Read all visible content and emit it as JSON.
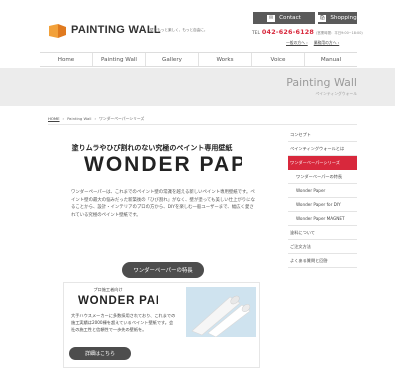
{
  "header": {
    "logo_text": "PAINTING WALL",
    "tagline": "壁をもっと楽しく、もっと自由に。",
    "contact_label": "Contact",
    "shop_label": "Shopping",
    "tel_prefix": "TEL",
    "tel_number": "042-626-6128",
    "tel_hours": "(営業時間：平日9:00~18:00)",
    "links": [
      "一般の方へ ›",
      "業務用の方へ ›"
    ]
  },
  "nav": {
    "items": [
      "Home",
      "Painting Wall",
      "Gallery",
      "Works",
      "Voice",
      "Manual"
    ]
  },
  "band": {
    "title": "Painting Wall",
    "subtitle": "ペインティングウォール"
  },
  "breadcrumb": {
    "items": [
      "HOME",
      "Painting Wall",
      "ワンダーペーパーシリーズ"
    ],
    "separator": "›"
  },
  "main": {
    "headline": "塗りムラやひび割れのない究極のペイント専用壁紙",
    "logo_big": "WONDER PAPER",
    "description": "ワンダーペーパーは、これまでのペイント壁の常識を越える新しいペイント専用壁紙です。ペイント壁の最大の悩みだった新築後の「ひび割れ」がなく、壁が塗っても美しい仕上がりになることから、設計・インテリアのプロの方から、DIYを楽しむ一般ユーザーまで、幅広く愛されている究極のペイント壁紙です。",
    "feature_button": "ワンダーペーパーの特長"
  },
  "card": {
    "kicker": "プロ施工者向け",
    "logo_small": "WONDER PAPER",
    "description": "大手ハウスメーカーに多数採用されており、これまでの施工実績は2000棟を超えているペイント壁紙です。会社の施工性と信頼性で一歩先の壁紙を。",
    "details_button": "詳細はこちら"
  },
  "sidebar": {
    "items": [
      {
        "label": "コンセプト",
        "sub": false,
        "active": false
      },
      {
        "label": "ペインティングウォールとは",
        "sub": false,
        "active": false
      },
      {
        "label": "ワンダーペーパーシリーズ",
        "sub": false,
        "active": true
      },
      {
        "label": "ワンダーペーパーの特長",
        "sub": true,
        "active": false
      },
      {
        "label": "Wonder Paper",
        "sub": true,
        "active": false
      },
      {
        "label": "Wonder Paper for DIY",
        "sub": true,
        "active": false
      },
      {
        "label": "Wonder Paper MAGNET",
        "sub": true,
        "active": false
      },
      {
        "label": "塗料について",
        "sub": false,
        "active": false
      },
      {
        "label": "ご注文方法",
        "sub": false,
        "active": false
      },
      {
        "label": "よくある質問と回答",
        "sub": false,
        "active": false
      }
    ]
  },
  "colors": {
    "accent": "#d8283c",
    "logo_orange": "#f2a13a",
    "button_dark": "#4d4d4d",
    "band_gray": "#ececec"
  }
}
